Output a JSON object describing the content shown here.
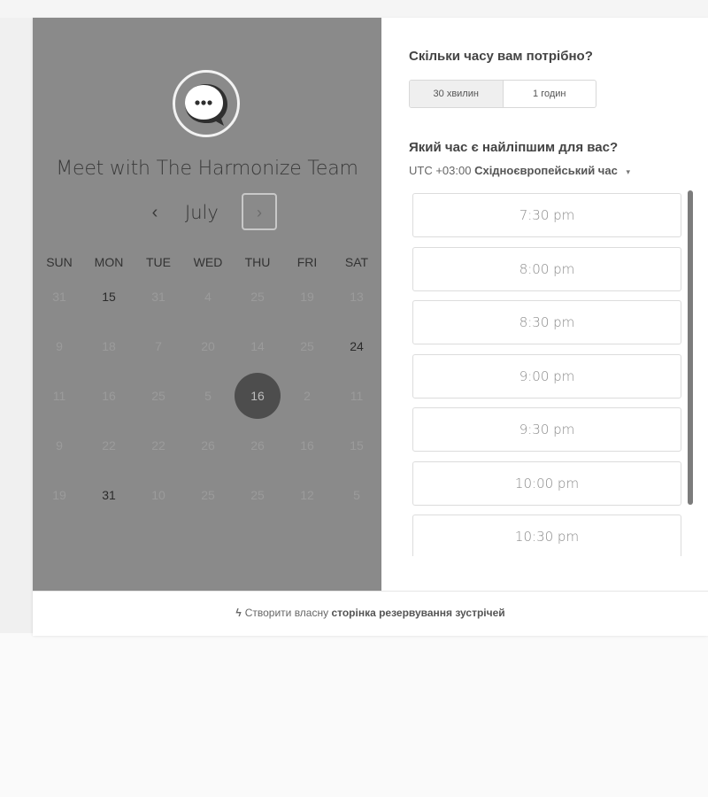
{
  "host": {
    "title": "Meet with The Harmonize Team",
    "logo_icon": "chat-bubble-icon"
  },
  "calendar": {
    "month": "July",
    "prev_icon": "chevron-left-icon",
    "next_icon": "chevron-right-icon",
    "prev_glyph": "‹",
    "next_glyph": "›",
    "weekdays": [
      "SUN",
      "MON",
      "TUE",
      "WED",
      "THU",
      "FRI",
      "SAT"
    ],
    "weeks": [
      [
        "31",
        "15",
        "31",
        "4",
        "25",
        "19",
        "13"
      ],
      [
        "9",
        "18",
        "7",
        "20",
        "14",
        "25",
        "24"
      ],
      [
        "11",
        "16",
        "25",
        "5",
        "16",
        "2",
        "11"
      ],
      [
        "9",
        "22",
        "22",
        "26",
        "26",
        "16",
        "15"
      ],
      [
        "19",
        "31",
        "10",
        "25",
        "25",
        "12",
        "5"
      ]
    ],
    "available": [
      [
        0,
        1
      ],
      [
        1,
        6
      ],
      [
        4,
        1
      ]
    ],
    "selected": [
      2,
      4
    ]
  },
  "duration": {
    "question": "Скільки часу вам потрібно?",
    "options": [
      "30 хвилин",
      "1 годин"
    ],
    "selected_index": 0
  },
  "time": {
    "question": "Який час є найліпшим для вас?",
    "timezone_prefix": "UTC +03:00",
    "timezone_name": "Східноєвропейський час",
    "caret_glyph": "▾",
    "slots": [
      "7:30 pm",
      "8:00 pm",
      "8:30 pm",
      "9:00 pm",
      "9:30 pm",
      "10:00 pm",
      "10:30 pm"
    ]
  },
  "footer": {
    "icon": "hubspot-sprocket-icon",
    "icon_glyph": "ϟ",
    "prefix": "Створити власну",
    "link": "сторінка резервування зустрічей"
  },
  "colors": {
    "left_panel_bg": "#8a8a8a",
    "selected_day_bg": "#4d4d4d"
  }
}
